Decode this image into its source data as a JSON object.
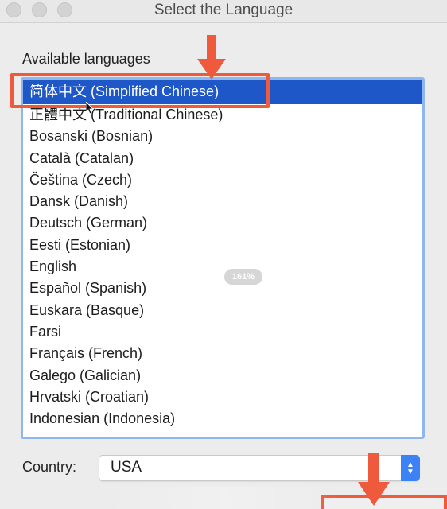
{
  "window": {
    "title": "Select the Language"
  },
  "languages_panel": {
    "label": "Available languages",
    "items": [
      "简体中文 (Simplified Chinese)",
      "正體中文 (Traditional Chinese)",
      "Bosanski (Bosnian)",
      "Català (Catalan)",
      "Čeština (Czech)",
      "Dansk (Danish)",
      "Deutsch (German)",
      "Eesti (Estonian)",
      "English",
      "Español (Spanish)",
      "Euskara (Basque)",
      "Farsi",
      "Français (French)",
      "Galego (Galician)",
      "Hrvatski (Croatian)",
      "Indonesian (Indonesia)"
    ],
    "selected_index": 0
  },
  "country": {
    "label": "Country:",
    "value": "USA"
  },
  "zoom_badge": "161%",
  "colors": {
    "selection": "#1e57c8",
    "annotation": "#ef5a3c",
    "focus_ring": "#8fb7ef",
    "stepper": "#3b82f6"
  },
  "icons": {
    "annotation_arrow": "arrow-down-icon",
    "stepper": "chevron-updown-icon"
  }
}
